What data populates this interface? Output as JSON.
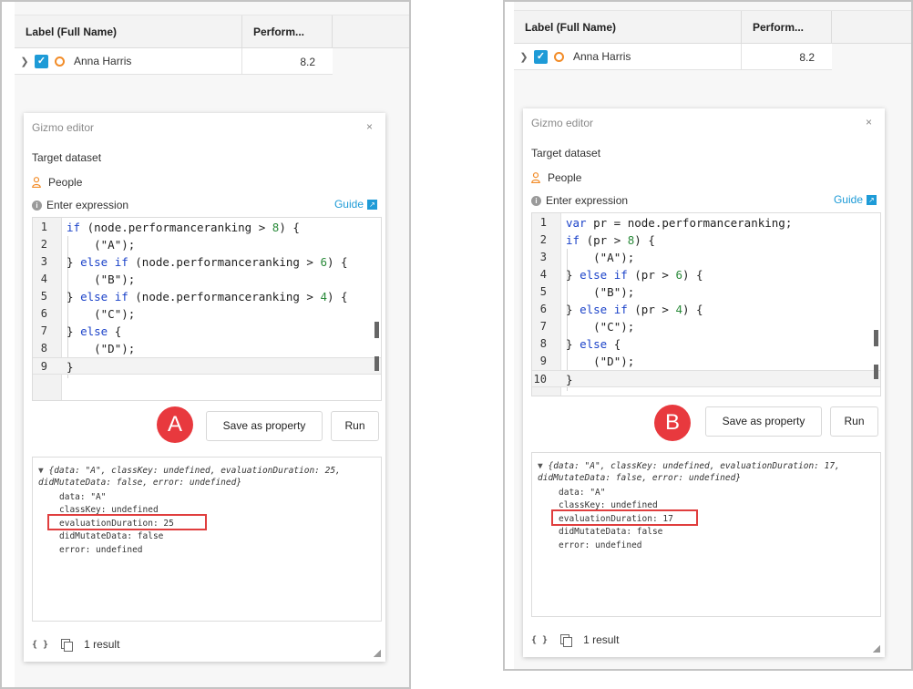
{
  "table": {
    "col_label": "Label (Full Name)",
    "col_perf": "Perform...",
    "row_name": "Anna Harris",
    "row_value": "8.2"
  },
  "editor": {
    "title": "Gizmo editor",
    "close": "×",
    "target_label": "Target dataset",
    "dataset": "People",
    "expr_label": "Enter expression",
    "guide": "Guide",
    "save_button": "Save as property",
    "run_button": "Run",
    "result_count": "1 result"
  },
  "icons": [
    "chevron-right-icon",
    "checkbox-checked-icon",
    "node-ring-icon",
    "person-icon",
    "info-icon",
    "external-link-icon",
    "close-icon",
    "braces-icon",
    "copy-icon",
    "resize-handle-icon"
  ],
  "colors": {
    "accent": "#1e9bd7",
    "node_ring": "#f28c28",
    "badge": "#e8393e",
    "highlight": "#e03e3e"
  },
  "variant_a": {
    "badge": "A",
    "code_lines": [
      "if (node.performanceranking > 8) {",
      "    (\"A\");",
      "} else if (node.performanceranking > 6) {",
      "    (\"B\");",
      "} else if (node.performanceranking > 4) {",
      "    (\"C\");",
      "} else {",
      "    (\"D\");",
      "}"
    ],
    "output_summary": "{data: \"A\", classKey: undefined, evaluationDuration: 25, didMutateData: false, error: undefined}",
    "prop_data": "data: \"A\"",
    "prop_classkey": "classKey: undefined",
    "prop_duration": "evaluationDuration: 25",
    "prop_mutate": "didMutateData: false",
    "prop_error": "error: undefined"
  },
  "variant_b": {
    "badge": "B",
    "code_lines": [
      "var pr = node.performanceranking;",
      "if (pr > 8) {",
      "    (\"A\");",
      "} else if (pr > 6) {",
      "    (\"B\");",
      "} else if (pr > 4) {",
      "    (\"C\");",
      "} else {",
      "    (\"D\");",
      "}"
    ],
    "output_summary": "{data: \"A\", classKey: undefined, evaluationDuration: 17, didMutateData: false, error: undefined}",
    "prop_data": "data: \"A\"",
    "prop_classkey": "classKey: undefined",
    "prop_duration": "evaluationDuration: 17",
    "prop_mutate": "didMutateData: false",
    "prop_error": "error: undefined"
  }
}
